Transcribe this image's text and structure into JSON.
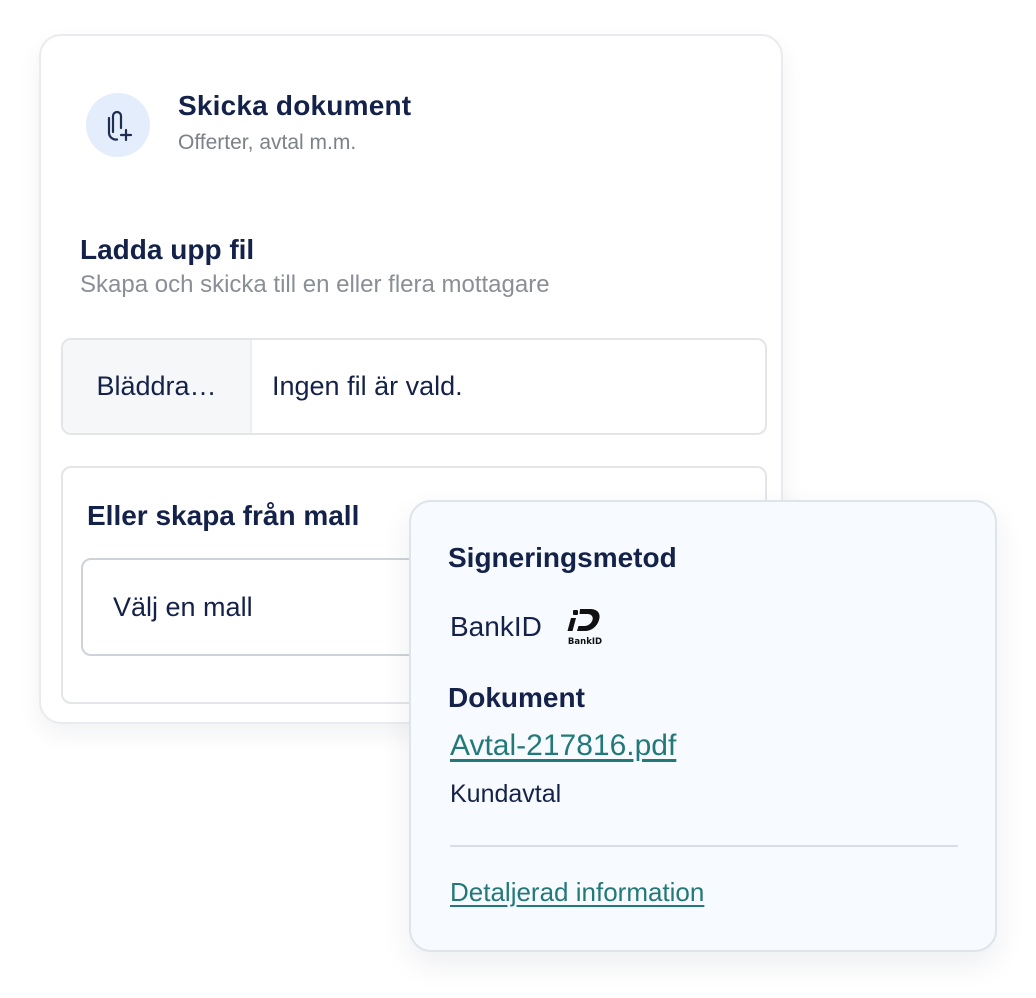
{
  "header": {
    "icon": "paperclip-plus-icon",
    "title": "Skicka dokument",
    "subtitle": "Offerter, avtal m.m."
  },
  "upload": {
    "title": "Ladda upp fil",
    "subtitle": "Skapa och skicka till en eller flera mottagare",
    "browse_label": "Bläddra…",
    "file_status": "Ingen fil är vald."
  },
  "template": {
    "title": "Eller skapa från mall",
    "select_value": "Välj en mall"
  },
  "summary": {
    "signing_title": "Signeringsmetod",
    "signing_method": "BankID",
    "signing_icon": "bankid-logo-icon",
    "bankid_logo_text": "BankID",
    "document_title": "Dokument",
    "document_link": "Avtal-217816.pdf",
    "document_type": "Kundavtal",
    "details_link": "Detaljerad information"
  },
  "colors": {
    "navy": "#14224a",
    "link_teal": "#23797a",
    "icon_bg": "#e3edfb",
    "muted_text": "#8a8f96",
    "overlay_bg": "#f7fafe"
  }
}
